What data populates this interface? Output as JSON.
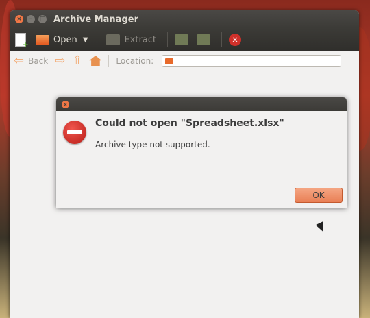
{
  "window": {
    "title": "Archive Manager"
  },
  "toolbar": {
    "new_icon": "new-archive-icon",
    "open_label": "Open",
    "extract_label": "Extract",
    "add_files_icon": "add-files-icon",
    "add_folder_icon": "add-folder-icon",
    "stop_icon": "stop-icon"
  },
  "nav": {
    "back_label": "Back",
    "location_label": "Location:",
    "location_value": ""
  },
  "dialog": {
    "heading": "Could not open \"Spreadsheet.xlsx\"",
    "message": "Archive type not supported.",
    "ok_label": "OK",
    "icon": "error-icon"
  },
  "colors": {
    "accent": "#f07746",
    "error": "#d0302a",
    "ok_button": "#e97f55"
  }
}
